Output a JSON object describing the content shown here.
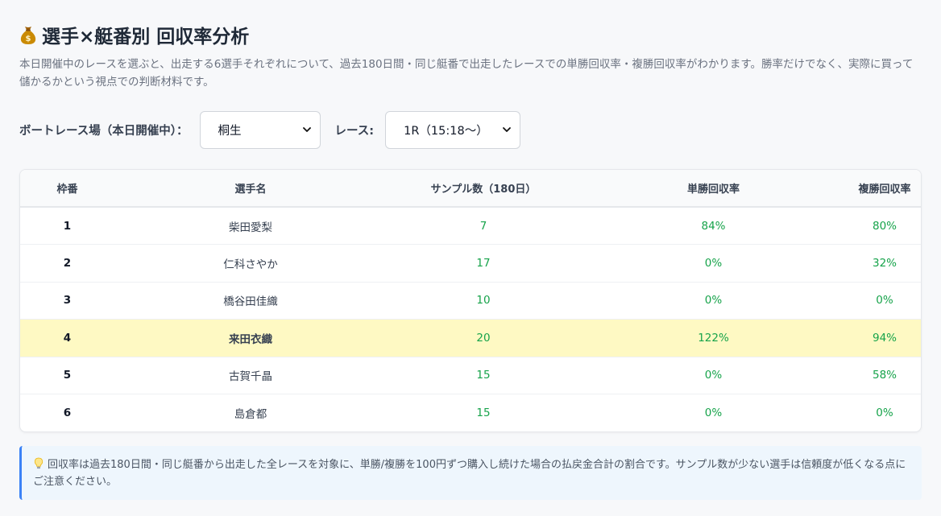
{
  "header": {
    "title": "選手×艇番別 回収率分析",
    "description": "本日開催中のレースを選ぶと、出走する6選手それぞれについて、過去180日間・同じ艇番で出走したレースでの単勝回収率・複勝回収率がわかります。勝率だけでなく、実際に買って儲かるかという視点での判断材料です。"
  },
  "controls": {
    "venue_label": "ボートレース場（本日開催中）：",
    "venue_value": "桐生",
    "race_label": "レース:",
    "race_value": "1R（15:18〜）"
  },
  "table": {
    "headers": [
      "枠番",
      "選手名",
      "サンプル数（180日）",
      "単勝回収率",
      "複勝回収率"
    ],
    "rows": [
      {
        "lane": "1",
        "name": "柴田愛梨",
        "samples": "7",
        "win": "84%",
        "place": "80%"
      },
      {
        "lane": "2",
        "name": "仁科さやか",
        "samples": "17",
        "win": "0%",
        "place": "32%"
      },
      {
        "lane": "3",
        "name": "橋谷田佳織",
        "samples": "10",
        "win": "0%",
        "place": "0%"
      },
      {
        "lane": "4",
        "name": "来田衣織",
        "samples": "20",
        "win": "122%",
        "place": "94%"
      },
      {
        "lane": "5",
        "name": "古賀千晶",
        "samples": "15",
        "win": "0%",
        "place": "58%"
      },
      {
        "lane": "6",
        "name": "島倉都",
        "samples": "15",
        "win": "0%",
        "place": "0%"
      }
    ]
  },
  "note": {
    "icon": "lightbulb-icon",
    "text": "回収率は過去180日間・同じ艇番から出走した全レースを対象に、単勝/複勝を100円ずつ購入し続けた場合の払戻金合計の割合です。サンプル数が少ない選手は信頼度が低くなる点にご注意ください。"
  },
  "colors": {
    "accent": "#3b82f6",
    "value_green": "#16a34a",
    "highlight_row": "#fef9c3"
  }
}
